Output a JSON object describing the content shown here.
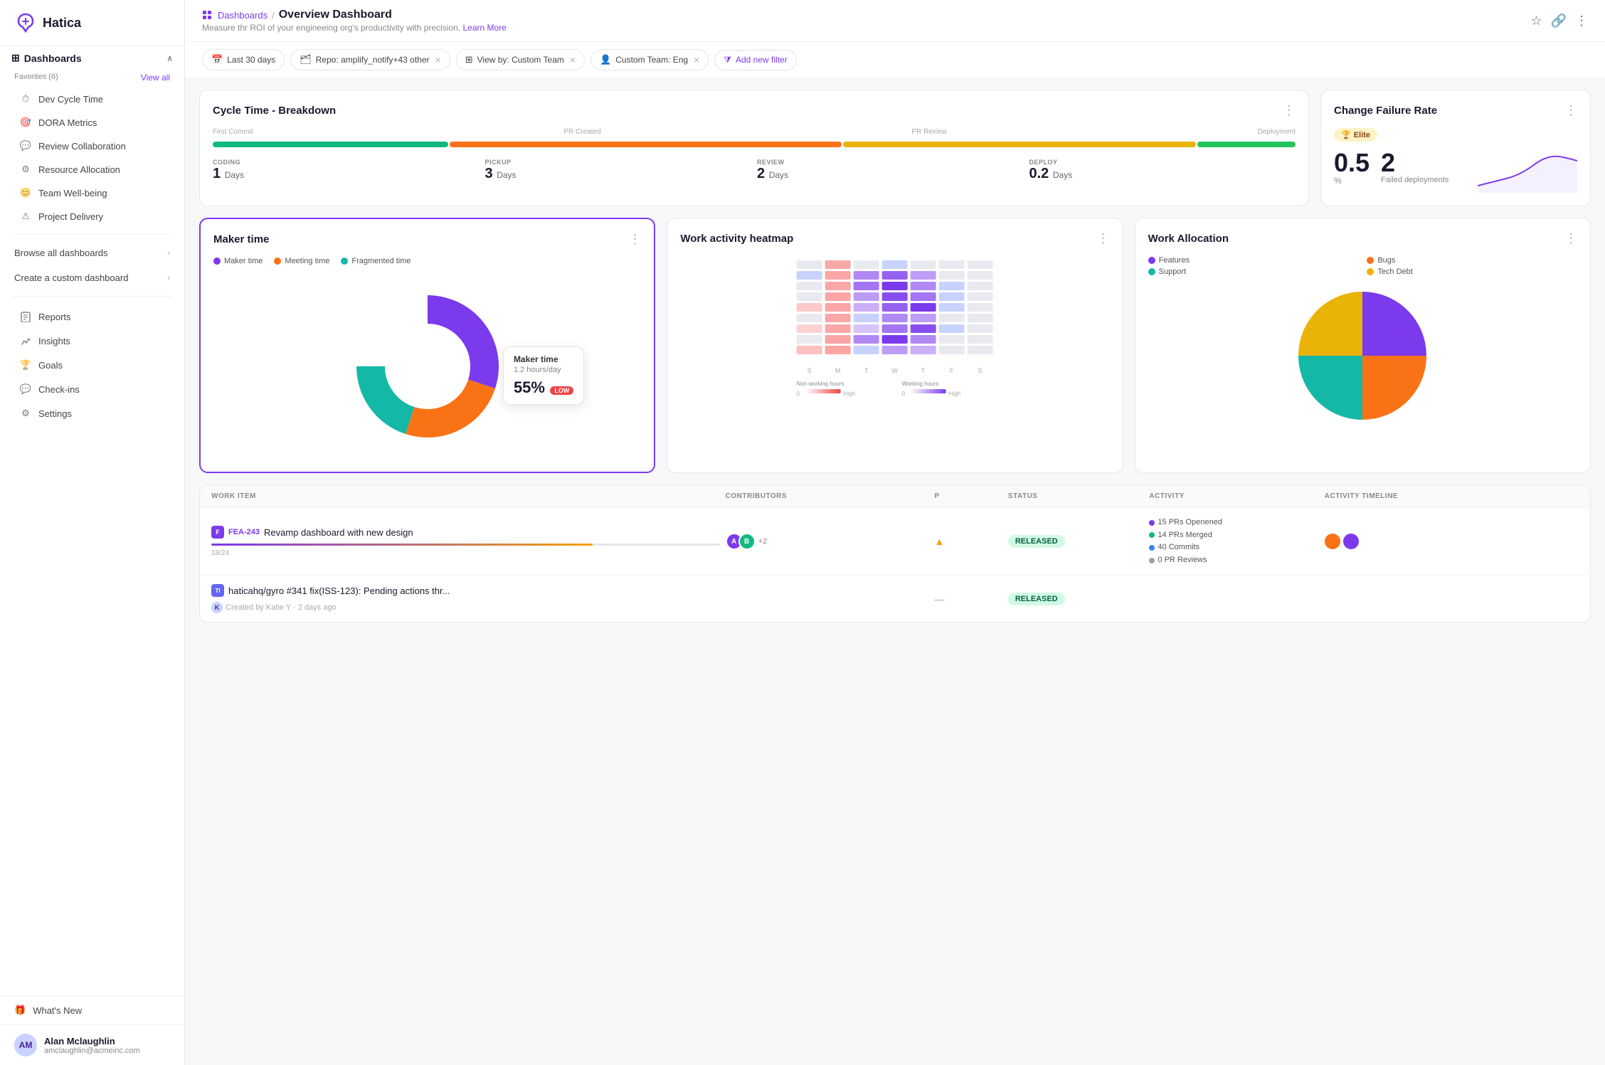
{
  "app": {
    "name": "Hatica"
  },
  "sidebar": {
    "dashboards_label": "Dashboards",
    "favorites_label": "Favorites (6)",
    "view_all": "View all",
    "favorites": [
      {
        "id": "dev-cycle-time",
        "label": "Dev Cycle Time",
        "icon": "⏱"
      },
      {
        "id": "dora-metrics",
        "label": "DORA Metrics",
        "icon": "🎯"
      },
      {
        "id": "review-collaboration",
        "label": "Review Collaboration",
        "icon": "💬"
      },
      {
        "id": "resource-allocation",
        "label": "Resource Allocation",
        "icon": "⚙"
      },
      {
        "id": "team-wellbeing",
        "label": "Team Well-being",
        "icon": "😊"
      },
      {
        "id": "project-delivery",
        "label": "Project Delivery",
        "icon": "⚠"
      }
    ],
    "browse_label": "Browse all dashboards",
    "create_label": "Create a custom dashboard",
    "nav_items": [
      {
        "id": "reports",
        "label": "Reports",
        "icon": "📄"
      },
      {
        "id": "insights",
        "label": "Insights",
        "icon": "⚡"
      },
      {
        "id": "goals",
        "label": "Goals",
        "icon": "🏆"
      },
      {
        "id": "check-ins",
        "label": "Check-ins",
        "icon": "💬"
      },
      {
        "id": "settings",
        "label": "Settings",
        "icon": "⚙"
      }
    ],
    "whats_new": "What's New",
    "user": {
      "name": "Alan Mclaughlin",
      "email": "amclaughlin@acmeinc.com",
      "initials": "AM"
    }
  },
  "header": {
    "breadcrumb_dashboards": "Dashboards",
    "separator": "/",
    "title": "Overview Dashboard",
    "subtitle": "Measure thr ROI of your engineeing org's productivity with precision.",
    "learn_more": "Learn More"
  },
  "filters": [
    {
      "id": "date-range",
      "icon": "📅",
      "label": "Last 30 days",
      "removable": false
    },
    {
      "id": "repo",
      "icon": "🗂",
      "label": "Repo: amplify_notify+43 other",
      "removable": true
    },
    {
      "id": "view-by",
      "icon": "⊞",
      "label": "View by: Custom Team",
      "removable": true
    },
    {
      "id": "custom-team",
      "icon": "👤",
      "label": "Custom Team: Eng",
      "removable": true
    }
  ],
  "add_filter_label": "Add new filter",
  "cards": {
    "cycle_time": {
      "title": "Cycle Time - Breakdown",
      "timeline_labels": [
        "First Commit",
        "PR Created",
        "PR Review",
        "Deployment"
      ],
      "stages": [
        {
          "id": "coding",
          "label": "CODING",
          "value": "1",
          "unit": "Days",
          "color": "#10b981",
          "bar_color": "#10b981"
        },
        {
          "id": "pickup",
          "label": "PICKUP",
          "value": "3",
          "unit": "Days",
          "color": "#f97316",
          "bar_color": "#f97316"
        },
        {
          "id": "review",
          "label": "REVIEW",
          "value": "2",
          "unit": "Days",
          "color": "#eab308",
          "bar_color": "#eab308"
        },
        {
          "id": "deploy",
          "label": "DEPLOY",
          "value": "0.2",
          "unit": "Days",
          "color": "#22c55e",
          "bar_color": "#22c55e"
        }
      ]
    },
    "change_failure_rate": {
      "title": "Change Failure Rate",
      "badge": "Elite",
      "badge_icon": "🏆",
      "rate_value": "0.5",
      "rate_unit": "%",
      "failed_value": "2",
      "failed_label": "Failed deployments"
    },
    "maker_time": {
      "title": "Maker time",
      "legend": [
        {
          "label": "Maker time",
          "color": "#7c3aed"
        },
        {
          "label": "Meeting time",
          "color": "#f97316"
        },
        {
          "label": "Fragmented time",
          "color": "#14b8a6"
        }
      ],
      "tooltip": {
        "title": "Maker time",
        "sub": "1.2 hours/day",
        "pct": "55%",
        "badge": "LOW"
      },
      "donut": {
        "segments": [
          {
            "label": "Maker time",
            "pct": 55,
            "color": "#7c3aed"
          },
          {
            "label": "Meeting time",
            "pct": 25,
            "color": "#f97316"
          },
          {
            "label": "Fragmented time",
            "pct": 20,
            "color": "#14b8a6"
          }
        ]
      }
    },
    "heatmap": {
      "title": "Work activity heatmap",
      "day_labels": [
        "S",
        "M",
        "T",
        "W",
        "T",
        "F",
        "S"
      ],
      "legend_left": {
        "label": "Non working hours",
        "low": "0",
        "high": "High"
      },
      "legend_right": {
        "label": "Working hours",
        "low": "0",
        "high": "High"
      }
    },
    "work_allocation": {
      "title": "Work Allocation",
      "legend": [
        {
          "label": "Features",
          "color": "#7c3aed"
        },
        {
          "label": "Bugs",
          "color": "#f97316"
        },
        {
          "label": "Support",
          "color": "#14b8a6"
        },
        {
          "label": "Tech Debt",
          "color": "#eab308"
        }
      ]
    }
  },
  "table": {
    "headers": [
      "WORK ITEM",
      "CONTRIBUTORS",
      "P",
      "STATUS",
      "ACTIVITY",
      "ACTIVITY TIMELINE"
    ],
    "rows": [
      {
        "id": "FEA-243",
        "title": "Revamp dashboard with new design",
        "progress_current": 18,
        "progress_total": 24,
        "contributors": [
          "#7c3aed",
          "#10b981"
        ],
        "extra_contributors": "+2",
        "priority": "up",
        "status": "RELEASED",
        "activity": [
          {
            "text": "15 PRs Openened",
            "color": "#7c3aed"
          },
          {
            "text": "14 PRs Merged",
            "color": "#10b981"
          },
          {
            "text": "40 Commits",
            "color": "#3b82f6"
          },
          {
            "text": "0 PR Reviews",
            "color": "#94a3b8"
          }
        ],
        "timeline_colors": [
          "#f97316",
          "#7c3aed"
        ]
      },
      {
        "id": "haticahq/gyro #341",
        "title": "fix(ISS-123): Pending actions thr...",
        "created_by": "Katie Y",
        "time_ago": "2 days ago",
        "contributors": [],
        "extra_contributors": "",
        "priority": "none",
        "status": "RELEASED",
        "activity": [],
        "timeline_colors": []
      }
    ]
  }
}
